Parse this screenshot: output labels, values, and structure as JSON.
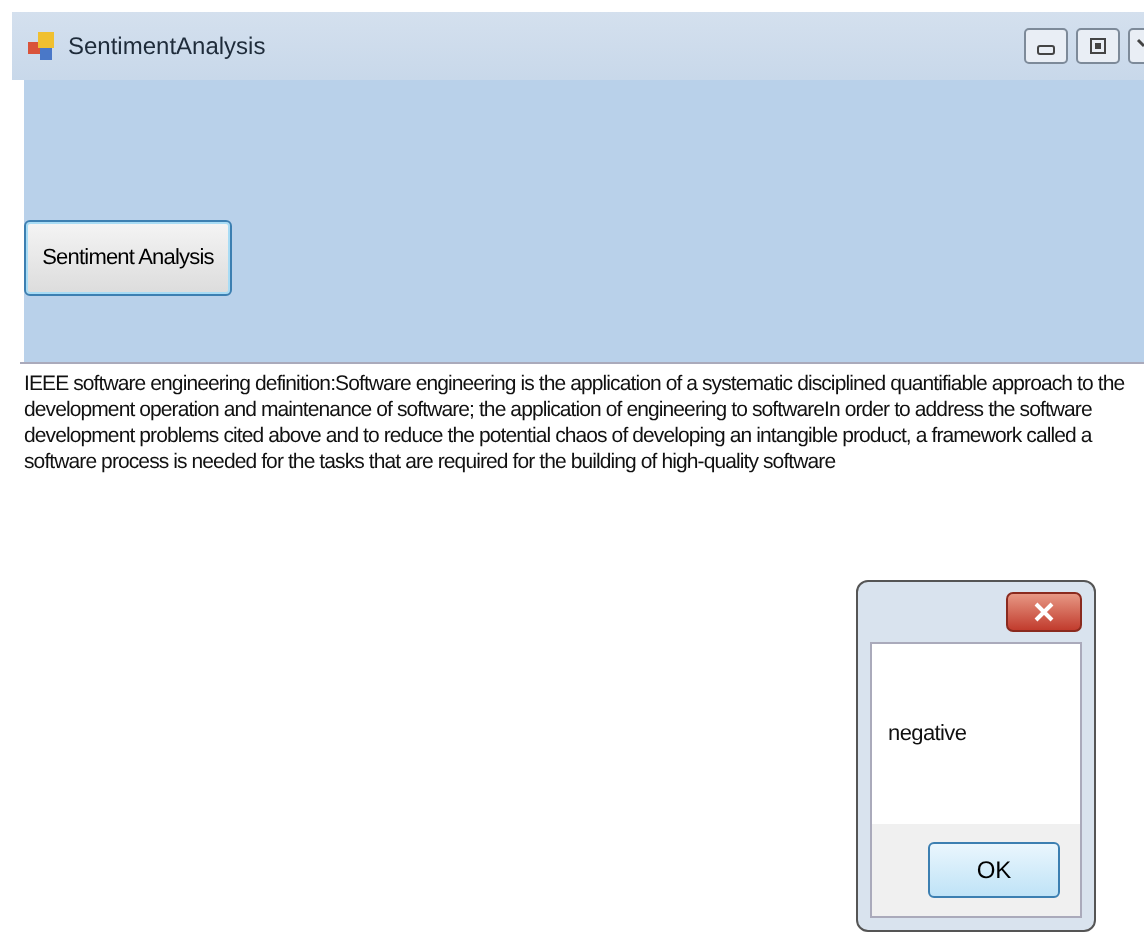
{
  "window": {
    "title": "SentimentAnalysis"
  },
  "button": {
    "label": "Sentiment Analysis"
  },
  "text": "IEEE software engineering definition:Software engineering is the application of a systematic disciplined quantifiable approach to the development operation and maintenance of software; the application of engineering to softwareIn order to address the software development problems cited above and to reduce the potential chaos of developing an intangible product, a framework called a software process is needed for the tasks that are required for the building of high-quality software",
  "dialog": {
    "message": "negative",
    "button": "OK"
  }
}
